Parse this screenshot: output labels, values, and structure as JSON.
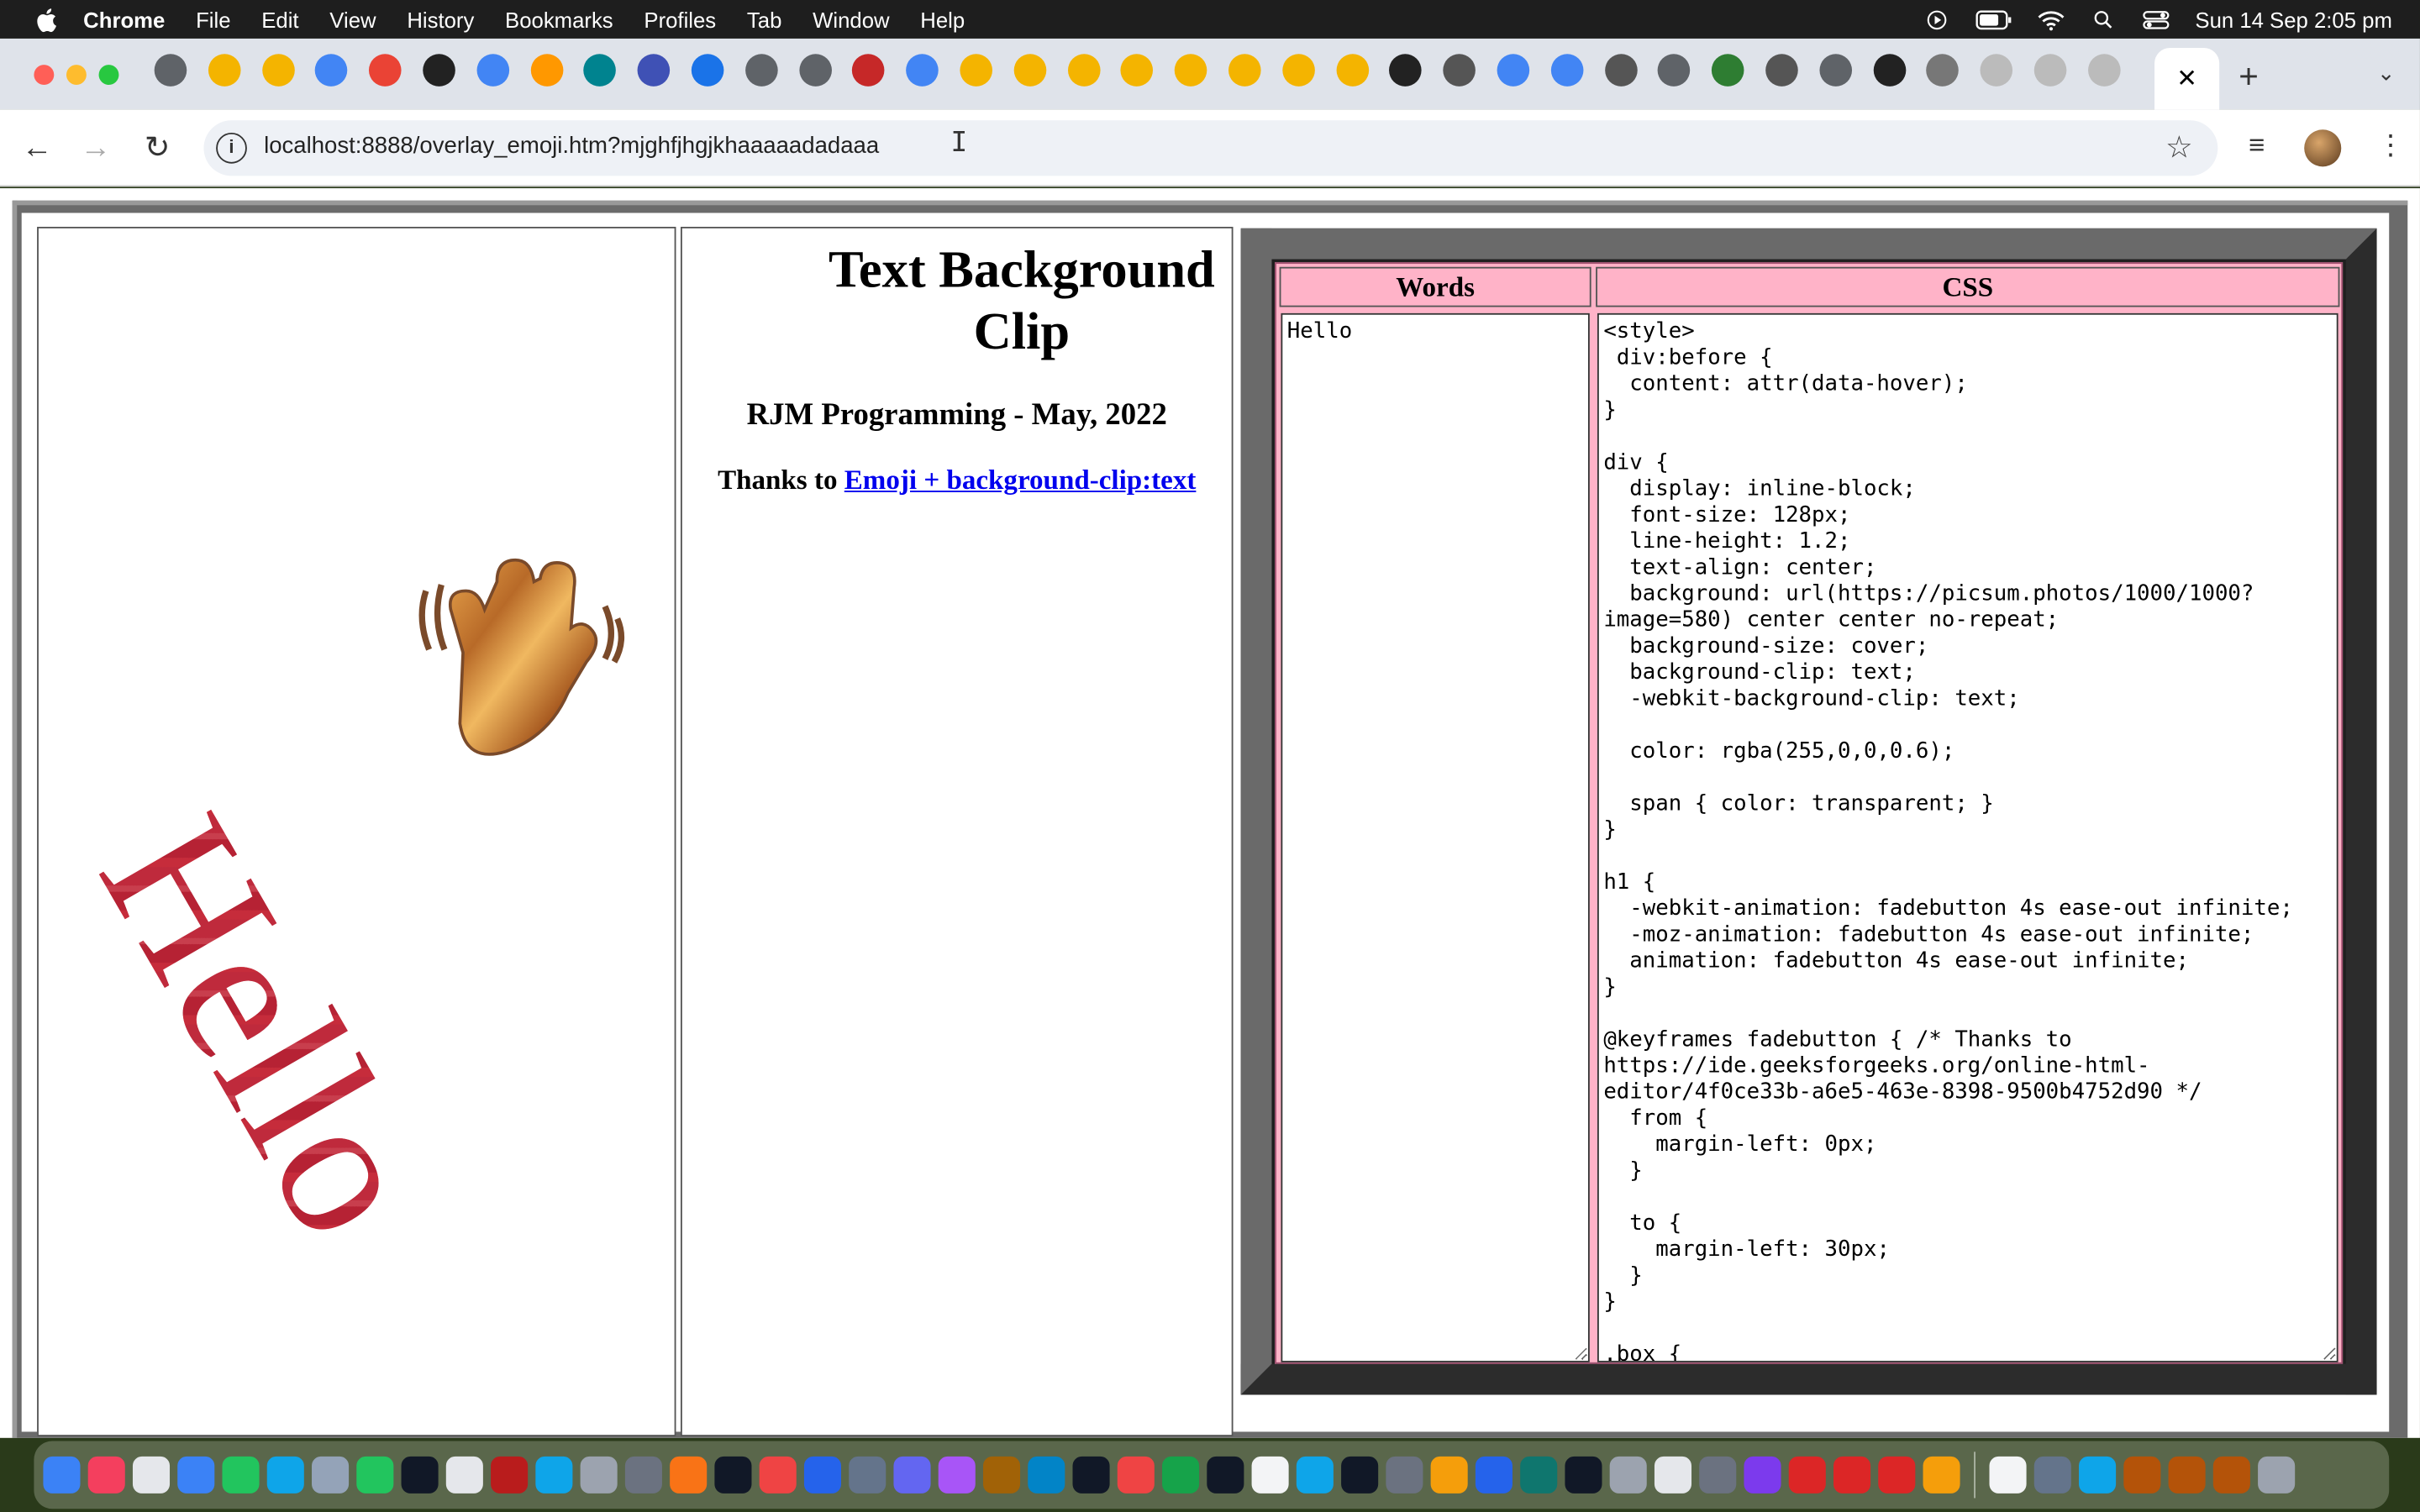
{
  "menubar": {
    "app": "Chrome",
    "items": [
      "File",
      "Edit",
      "View",
      "History",
      "Bookmarks",
      "Profiles",
      "Tab",
      "Window",
      "Help"
    ],
    "clock": "Sun 14 Sep  2:05 pm"
  },
  "tabs": {
    "favicons": [
      "#5f6368",
      "#f4b400",
      "#f4b400",
      "#4285f4",
      "#ea4335",
      "#222",
      "#4285f4",
      "#ff9800",
      "#00838f",
      "#3f51b5",
      "#1a73e8",
      "#5f6368",
      "#5f6368",
      "#c62828",
      "#4285f4",
      "#f4b400",
      "#f4b400",
      "#f4b400",
      "#f4b400",
      "#f4b400",
      "#f4b400",
      "#f4b400",
      "#f4b400",
      "#222",
      "#555",
      "#4285f4",
      "#4285f4",
      "#555",
      "#5f6368",
      "#2e7d32",
      "#555",
      "#5f6368",
      "#222",
      "#777",
      "#bbb",
      "#bbb",
      "#bbb"
    ],
    "active_close": "✕",
    "new_tab": "+"
  },
  "toolbar": {
    "url": "localhost:8888/overlay_emoji.htm?mjghfjhgjkhaaaaadadaaa"
  },
  "page": {
    "hello_text": "Hello",
    "title": "Text Background Clip",
    "subtitle": "RJM Programming - May, 2022",
    "thanks_prefix": "Thanks to ",
    "thanks_link": "Emoji + background-clip:text",
    "table": {
      "col_words": "Words",
      "col_css": "CSS",
      "words_value": "Hello",
      "css_value": "<style>\n div:before {\n  content: attr(data-hover);\n}\n\ndiv {\n  display: inline-block;\n  font-size: 128px;\n  line-height: 1.2;\n  text-align: center;\n  background: url(https://picsum.photos/1000/1000?image=580) center center no-repeat;\n  background-size: cover;\n  background-clip: text;\n  -webkit-background-clip: text;\n\n  color: rgba(255,0,0,0.6);\n\n  span { color: transparent; }\n}\n\nh1 {\n  -webkit-animation: fadebutton 4s ease-out infinite;\n  -moz-animation: fadebutton 4s ease-out infinite;\n  animation: fadebutton 4s ease-out infinite;\n}\n\n@keyframes fadebutton { /* Thanks to https://ide.geeksforgeeks.org/online-html-editor/4f0ce33b-a6e5-463e-8398-9500b4752d90 */\n  from {\n    margin-left: 0px;\n  }\n\n  to {\n    margin-left: 30px;\n  }\n}\n\n.box {"
    }
  },
  "dock": {
    "icons": [
      "#3b82f6",
      "#f43f5e",
      "#e5e7eb",
      "#3b82f6",
      "#22c55e",
      "#0ea5e9",
      "#94a3b8",
      "#22c55e",
      "#111827",
      "#e5e7eb",
      "#b91c1c",
      "#0ea5e9",
      "#9ca3af",
      "#6b7280",
      "#f97316",
      "#111827",
      "#ef4444",
      "#2563eb",
      "#64748b",
      "#6366f1",
      "#a855f7",
      "#a16207",
      "#0284c7",
      "#111827",
      "#ef4444",
      "#16a34a",
      "#111827",
      "#f3f4f6",
      "#0ea5e9",
      "#111827",
      "#6b7280",
      "#f59e0b",
      "#2563eb",
      "#0f766e",
      "#111827",
      "#9ca3af",
      "#e5e7eb",
      "#6b7280",
      "#7c3aed",
      "#dc2626",
      "#dc2626",
      "#dc2626",
      "#f59e0b",
      "#f3f4f6",
      "#64748b",
      "#0ea5e9",
      "#b45309",
      "#b45309",
      "#b45309",
      "#9ca3af"
    ]
  }
}
